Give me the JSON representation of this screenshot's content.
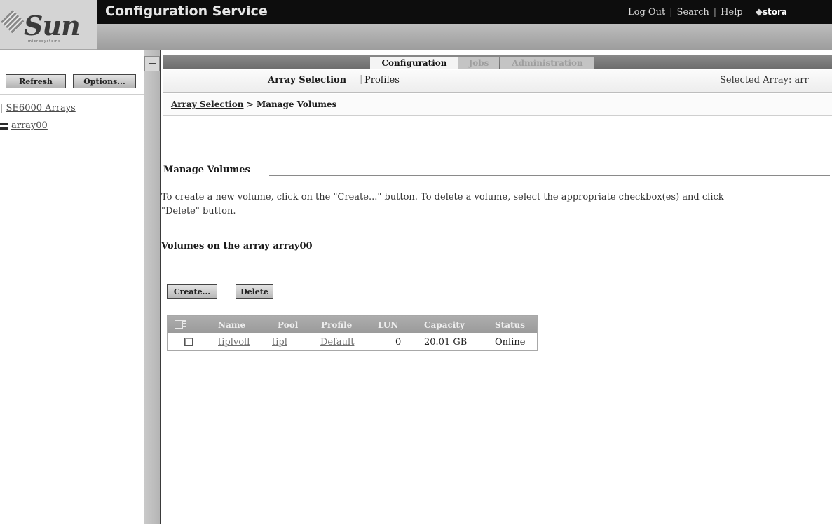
{
  "header": {
    "logo_text": "Sun",
    "logo_subtext": "microsystems",
    "app_title": "Configuration Service",
    "links": [
      "Log Out",
      "Search",
      "Help"
    ],
    "storage_link": "stora"
  },
  "sidebar": {
    "refresh_label": "Refresh",
    "options_label": "Options...",
    "tree": {
      "root_label": "SE6000 Arrays",
      "array_label": "array00"
    }
  },
  "tabs": [
    {
      "label": "Configuration",
      "active": true
    },
    {
      "label": "Jobs",
      "active": false
    },
    {
      "label": "Administration",
      "active": false
    }
  ],
  "subnav": {
    "items": [
      "Array Selection",
      "Profiles"
    ],
    "selected_array_label": "Selected Array: arr"
  },
  "breadcrumb": {
    "parent": "Array Selection",
    "separator": ">",
    "current": "Manage Volumes"
  },
  "main": {
    "section_title": "Manage Volumes",
    "instructions_line1": "To create a new volume, click on the \"Create...\" button. To delete a volume, select the appropriate checkbox(es) and click",
    "instructions_line2": "\"Delete\" button.",
    "subsection_title": "Volumes on the array array00",
    "create_label": "Create...",
    "delete_label": "Delete"
  },
  "volumes_table": {
    "columns": [
      "Name",
      "Pool",
      "Profile",
      "LUN",
      "Capacity",
      "Status"
    ],
    "rows": [
      {
        "name": "tiplvoll",
        "pool": "tipl",
        "profile": "Default",
        "lun": "0",
        "capacity": "20.01 GB",
        "status": "Online"
      }
    ]
  },
  "colors": {
    "title_bar": "#0d0d0d",
    "masthead": "#b0b0b0",
    "tab_strip": "#7a7a7a",
    "table_header": "#a3a3a3"
  }
}
